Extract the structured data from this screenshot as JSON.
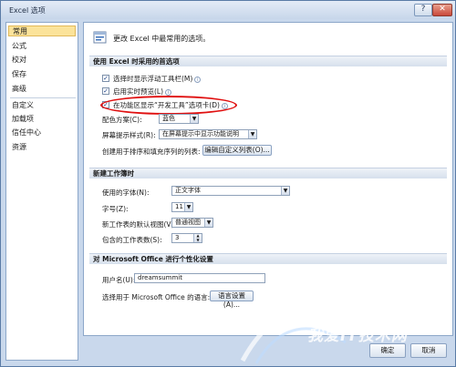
{
  "window": {
    "title": "Excel 选项",
    "help_label": "?",
    "close_label": "✕"
  },
  "sidebar": {
    "items": [
      {
        "label": "常用",
        "active": true
      },
      {
        "label": "公式"
      },
      {
        "label": "校对"
      },
      {
        "label": "保存"
      },
      {
        "label": "高级"
      },
      {
        "label": "自定义"
      },
      {
        "label": "加载项"
      },
      {
        "label": "信任中心"
      },
      {
        "label": "资源"
      }
    ]
  },
  "header": {
    "text": "更改 Excel 中最常用的选项。"
  },
  "sections": {
    "top_options": {
      "title": "使用 Excel 时采用的首选项",
      "checkboxes": [
        {
          "label": "选择时显示浮动工具栏(M)",
          "checked": true
        },
        {
          "label": "启用实时预览(L)",
          "checked": true
        },
        {
          "label": "在功能区显示“开发工具”选项卡(D)",
          "checked": true
        }
      ],
      "color_scheme": {
        "label": "配色方案(C):",
        "value": "蓝色"
      },
      "screentip_style": {
        "label": "屏幕提示样式(R):",
        "value": "在屏幕提示中显示功能说明"
      },
      "custom_lists": {
        "label": "创建用于排序和填充序列的列表:",
        "button": "编辑自定义列表(O)..."
      }
    },
    "new_workbook": {
      "title": "新建工作簿时",
      "font": {
        "label": "使用的字体(N):",
        "value": "正文字体"
      },
      "font_size": {
        "label": "字号(Z):",
        "value": "11"
      },
      "default_view": {
        "label": "新工作表的默认视图(V):",
        "value": "普通视图"
      },
      "sheet_count": {
        "label": "包含的工作表数(S):",
        "value": "3"
      }
    },
    "personalize": {
      "title": "对 Microsoft Office 进行个性化设置",
      "user_name": {
        "label": "用户名(U):",
        "value": "dreamsummit"
      },
      "language": {
        "label": "选择用于 Microsoft Office 的语言:",
        "button": "语言设置(A)..."
      }
    }
  },
  "footer": {
    "ok_label": "确定",
    "cancel_label": "取消"
  },
  "watermark": {
    "text": "我爱IT技术网"
  },
  "colors": {
    "accent_blue": "#c9d8ec",
    "highlight_red": "#e01010",
    "active_item": "#fbe39a"
  }
}
